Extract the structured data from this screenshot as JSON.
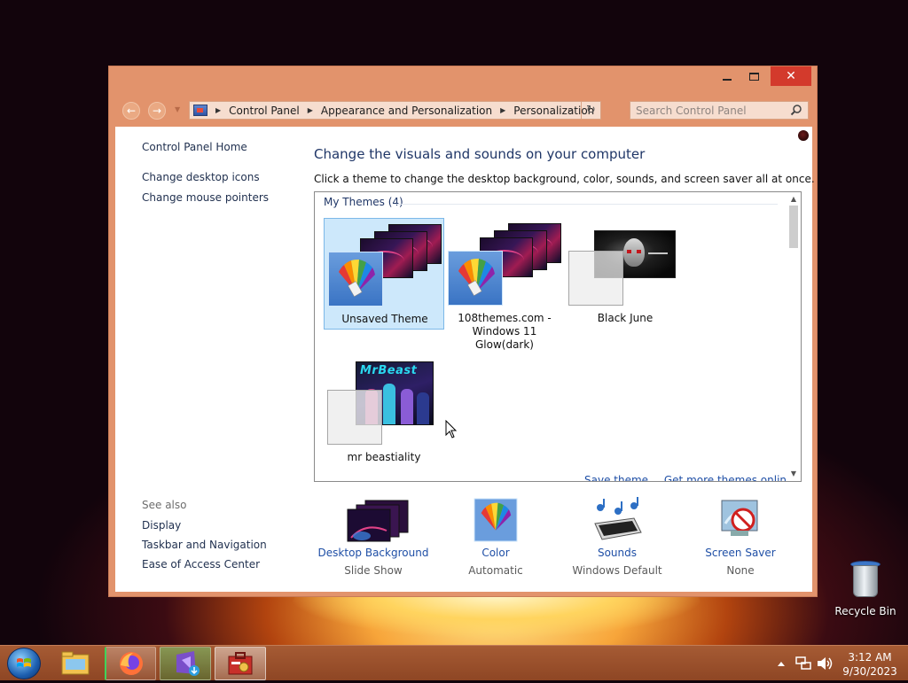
{
  "window": {
    "controls": {
      "minimize": "minimize",
      "maximize": "maximize",
      "close": "✕"
    }
  },
  "nav": {
    "breadcrumbs": [
      "Control Panel",
      "Appearance and Personalization",
      "Personalization"
    ],
    "search_placeholder": "Search Control Panel"
  },
  "sidebar": {
    "home": "Control Panel Home",
    "links": [
      "Change desktop icons",
      "Change mouse pointers"
    ],
    "see_also_header": "See also",
    "see_also": [
      "Display",
      "Taskbar and Navigation",
      "Ease of Access Center"
    ]
  },
  "main": {
    "title": "Change the visuals and sounds on your computer",
    "subtitle": "Click a theme to change the desktop background, color, sounds, and screen saver all at once.",
    "group_header": "My Themes (4)",
    "themes": [
      {
        "name": "Unsaved Theme",
        "selected": true
      },
      {
        "name": "108themes.com - Windows 11 Glow(dark)",
        "selected": false
      },
      {
        "name": "Black June",
        "selected": false
      },
      {
        "name": "mr beastiality",
        "selected": false
      }
    ],
    "thumbnail_text": {
      "beast_title": "MrBeast"
    },
    "box_links": [
      "Save theme",
      "Get more themes online"
    ]
  },
  "quick_links": [
    {
      "title": "Desktop Background",
      "value": "Slide Show",
      "icon": "desktop-background-icon"
    },
    {
      "title": "Color",
      "value": "Automatic",
      "icon": "color-icon"
    },
    {
      "title": "Sounds",
      "value": "Windows Default",
      "icon": "sounds-icon"
    },
    {
      "title": "Screen Saver",
      "value": "None",
      "icon": "screen-saver-icon"
    }
  ],
  "desktop": {
    "recycle_bin": "Recycle Bin"
  },
  "taskbar": {
    "apps": [
      "file-explorer-icon",
      "firefox-icon",
      "visual-studio-installer-icon",
      "control-panel-icon"
    ],
    "time": "3:12 AM",
    "date": "9/30/2023"
  },
  "colors": {
    "window_frame": "#e2936c",
    "link": "#1f4fa6",
    "heading": "#1f3667",
    "selection": "#cde8fb",
    "close_button": "#d33a2c"
  }
}
